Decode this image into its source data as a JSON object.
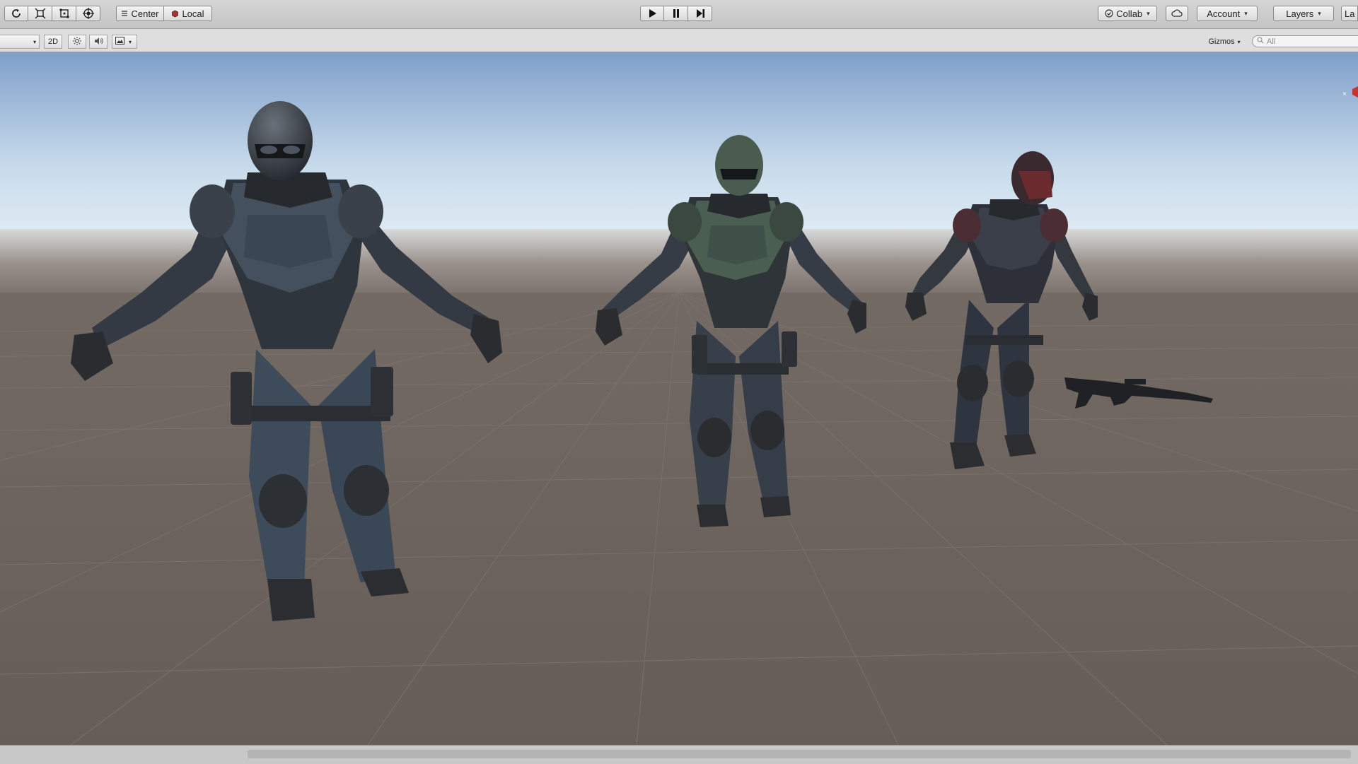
{
  "toolbar": {
    "transform_tools": [
      "rotate-tool",
      "scale-tool",
      "rect-tool",
      "transform-tool"
    ],
    "pivot_center_label": "Center",
    "pivot_local_label": "Local",
    "play_controls": [
      "play",
      "pause",
      "step"
    ],
    "collab_label": "Collab",
    "account_label": "Account",
    "layers_label": "Layers",
    "layout_label": "La"
  },
  "scene_toolbar": {
    "mode_label": "2D",
    "gizmos_label": "Gizmos",
    "search_placeholder": "All"
  },
  "scene": {
    "characters": [
      "soldier-blue",
      "soldier-green",
      "soldier-red"
    ],
    "props": [
      "assault-rifle"
    ],
    "colors": {
      "sky_top": "#7f9fc9",
      "sky_horizon": "#e9f1f7",
      "ground": "#6a605b",
      "armor_blue": "#3b4655",
      "armor_green": "#3f5148",
      "armor_red": "#4a2e33"
    }
  }
}
